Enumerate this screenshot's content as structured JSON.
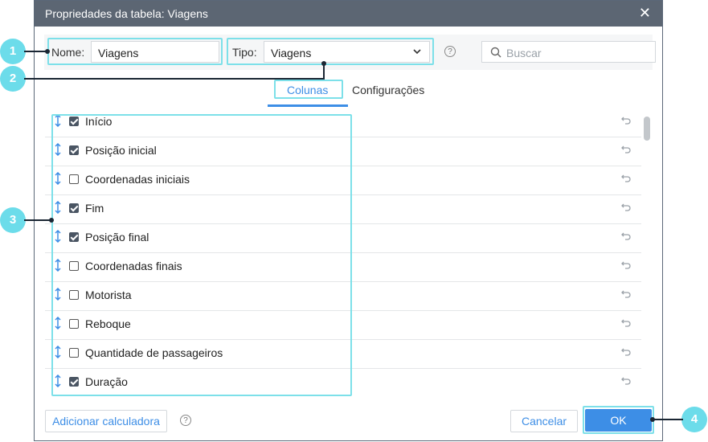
{
  "dialog": {
    "title": "Propriedades da tabela: Viagens",
    "close_symbol": "✕"
  },
  "fields": {
    "name_label": "Nome:",
    "name_value": "Viagens",
    "type_label": "Tipo:",
    "type_value": "Viagens",
    "search_placeholder": "Buscar",
    "help_symbol": "?"
  },
  "tabs": [
    {
      "label": "Colunas",
      "active": true
    },
    {
      "label": "Configurações",
      "active": false
    }
  ],
  "columns": [
    {
      "label": "Início",
      "checked": true
    },
    {
      "label": "Posição inicial",
      "checked": true
    },
    {
      "label": "Coordenadas iniciais",
      "checked": false
    },
    {
      "label": "Fim",
      "checked": true
    },
    {
      "label": "Posição final",
      "checked": true
    },
    {
      "label": "Coordenadas finais",
      "checked": false
    },
    {
      "label": "Motorista",
      "checked": false
    },
    {
      "label": "Reboque",
      "checked": false
    },
    {
      "label": "Quantidade de passageiros",
      "checked": false
    },
    {
      "label": "Duração",
      "checked": true
    }
  ],
  "footer": {
    "add_calculator_label": "Adicionar calculadora",
    "help_symbol": "?",
    "cancel_label": "Cancelar",
    "ok_label": "OK"
  },
  "callouts": [
    "1",
    "2",
    "3",
    "4"
  ],
  "colors": {
    "accent": "#3d8ee6",
    "highlight": "#7de0e9",
    "callout": "#6cdcea",
    "titlebar": "#5c6673"
  }
}
